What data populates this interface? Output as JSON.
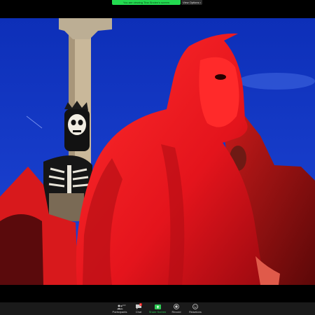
{
  "banner": {
    "sharing_text": "You are viewing Tina Sinden's screen",
    "view_options_label": "View Options",
    "chevron": "▾"
  },
  "toolbar": {
    "participants": {
      "label": "Participants",
      "count": "100",
      "icon": "participants-icon"
    },
    "chat": {
      "label": "Chat",
      "badge": "1",
      "icon": "chat-icon"
    },
    "share": {
      "label": "Share Screen",
      "icon": "share-screen-icon"
    },
    "record": {
      "label": "Record",
      "icon": "record-icon"
    },
    "reactions": {
      "label": "Reactions",
      "icon": "reactions-icon"
    },
    "caret": "^"
  },
  "colors": {
    "share_green": "#23d950",
    "toolbar_bg": "#1a1a1a",
    "sky_blue": "#1438c8",
    "robe_red": "#e8141e"
  }
}
